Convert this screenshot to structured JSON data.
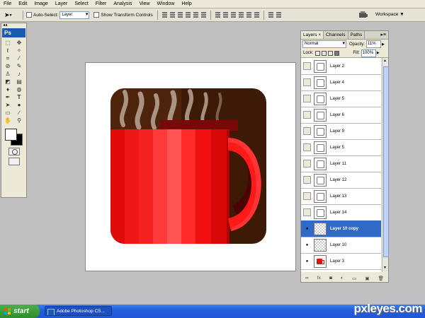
{
  "menu": [
    "File",
    "Edit",
    "Image",
    "Layer",
    "Select",
    "Filter",
    "Analysis",
    "View",
    "Window",
    "Help"
  ],
  "options": {
    "auto_select_label": "Auto-Select:",
    "auto_select_value": "Layer",
    "transform_label": "Show Transform Controls",
    "workspace_label": "Workspace ▼"
  },
  "toolbox": {
    "logo": "Ps",
    "handle": "◂◂"
  },
  "layers_panel": {
    "tabs": [
      {
        "label": "Layers",
        "close": "×",
        "active": true
      },
      {
        "label": "Channels"
      },
      {
        "label": "Paths"
      }
    ],
    "menu_icon": "▸≡",
    "blend_mode": "Normal",
    "opacity_label": "Opacity:",
    "opacity_value": "11%",
    "lock_label": "Lock:",
    "fill_label": "Fill:",
    "fill_value": "100%",
    "layers": [
      {
        "name": "Layer 2",
        "visible": false,
        "selected": false,
        "thumb": "glyph"
      },
      {
        "name": "Layer 4",
        "visible": false,
        "selected": false,
        "thumb": "glyph"
      },
      {
        "name": "Layer 5",
        "visible": false,
        "selected": false,
        "thumb": "glyph"
      },
      {
        "name": "Layer 6",
        "visible": false,
        "selected": false,
        "thumb": "glyph"
      },
      {
        "name": "Layer 9",
        "visible": false,
        "selected": false,
        "thumb": "glyph"
      },
      {
        "name": "Layer 5",
        "visible": false,
        "selected": false,
        "thumb": "glyph"
      },
      {
        "name": "Layer 11",
        "visible": false,
        "selected": false,
        "thumb": "glyph"
      },
      {
        "name": "Layer 12",
        "visible": false,
        "selected": false,
        "thumb": "glyph"
      },
      {
        "name": "Layer 13",
        "visible": false,
        "selected": false,
        "thumb": "glyph"
      },
      {
        "name": "Layer 14",
        "visible": false,
        "selected": false,
        "thumb": "glyph"
      },
      {
        "name": "Layer 10 copy",
        "visible": true,
        "selected": true,
        "thumb": "trans"
      },
      {
        "name": "Layer 10",
        "visible": true,
        "selected": false,
        "thumb": "trans"
      },
      {
        "name": "Layer 3",
        "visible": true,
        "selected": false,
        "thumb": "mug"
      }
    ],
    "bottom_icons": [
      "∞",
      "fx",
      "◙",
      "◐",
      "▭",
      "▣",
      "🗑"
    ]
  },
  "taskbar": {
    "start_label": "start",
    "task_label": "Adobe Photoshop CS...",
    "watermark": "pxleyes.com"
  },
  "colors": {
    "mug_red": "#ff0000",
    "coffee_brown": "#3d1a05",
    "selected_row": "#3169c6"
  }
}
